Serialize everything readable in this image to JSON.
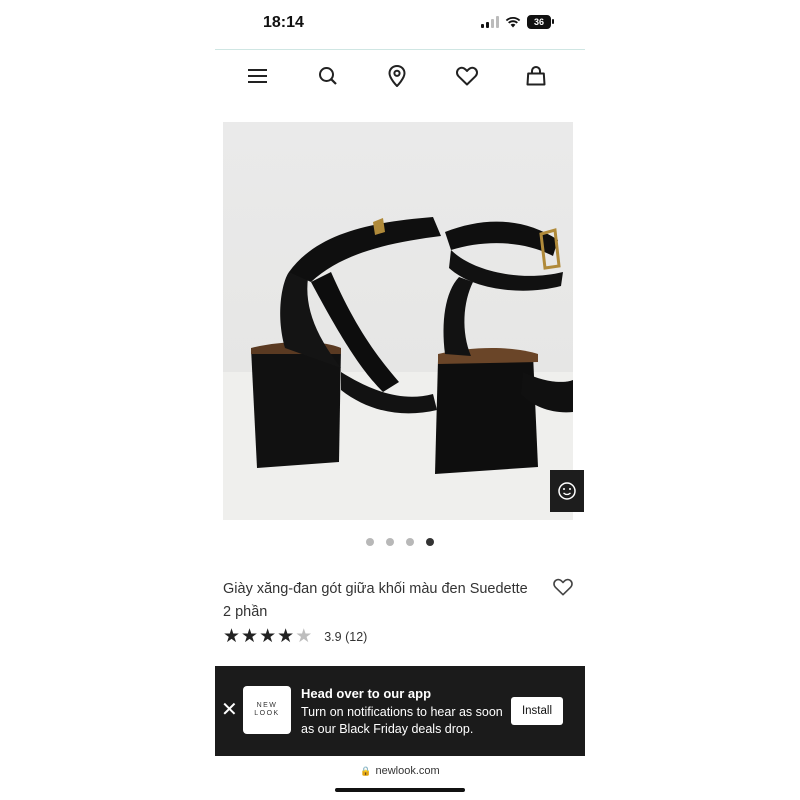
{
  "status_bar": {
    "time": "18:14",
    "battery": "36"
  },
  "nav": {
    "icons": [
      "menu-icon",
      "search-icon",
      "location-pin-icon",
      "heart-icon",
      "bag-icon"
    ]
  },
  "gallery": {
    "total_images": 4,
    "active_index": 3
  },
  "product": {
    "title": "Giày xăng-đan gót giữa khối màu đen Suedette 2 phần",
    "rating_value": 3.9,
    "rating_text": "3.9 (12)"
  },
  "app_banner": {
    "close": "✕",
    "logo_line1": "NEW",
    "logo_line2": "LOOK",
    "heading": "Head over to our app",
    "message": "Turn on notifications to hear as soon as our Black Friday deals drop.",
    "install_label": "Install"
  },
  "browser": {
    "url": "newlook.com"
  },
  "colors": {
    "banner_bg": "#1b1b1b",
    "accent_line": "#cfe6e3"
  }
}
